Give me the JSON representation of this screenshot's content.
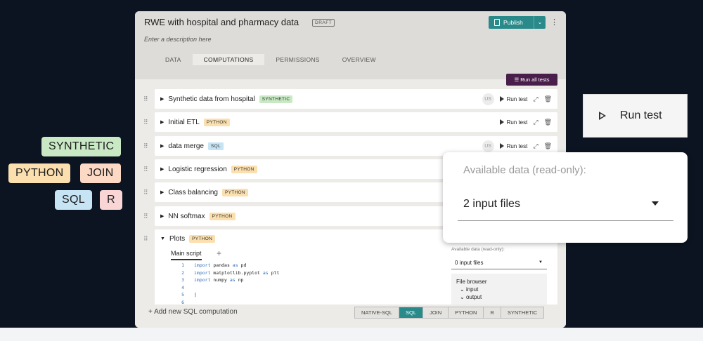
{
  "tags": [
    "SYNTHETIC",
    "PYTHON",
    "JOIN",
    "SQL",
    "R"
  ],
  "app": {
    "title": "RWE with hospital and pharmacy data",
    "status_badge": "DRAFT",
    "description_placeholder": "Enter a description here",
    "publish_label": "Publish",
    "tabs": [
      "DATA",
      "COMPUTATIONS",
      "PERMISSIONS",
      "OVERVIEW"
    ],
    "active_tab": "COMPUTATIONS",
    "run_all_label": "Run all tests"
  },
  "computations": [
    {
      "name": "Synthetic data from hospital",
      "type": "SYNTHETIC",
      "user": "US",
      "run": "Run test"
    },
    {
      "name": "Initial ETL",
      "type": "PYTHON",
      "run": "Run test"
    },
    {
      "name": "data merge",
      "type": "SQL",
      "user": "US",
      "run": "Run test"
    },
    {
      "name": "Logistic regression",
      "type": "PYTHON"
    },
    {
      "name": "Class balancing",
      "type": "PYTHON"
    },
    {
      "name": "NN softmax",
      "type": "PYTHON"
    }
  ],
  "expanded": {
    "name": "Plots",
    "type": "PYTHON",
    "tab_label": "Main script",
    "code_lines": [
      {
        "n": "1",
        "kw": "import",
        "rest": " pandas ",
        "kw2": "as",
        "rest2": " pd"
      },
      {
        "n": "2",
        "kw": "import",
        "rest": " matplotlib.pyplot ",
        "kw2": "as",
        "rest2": " plt"
      },
      {
        "n": "3",
        "kw": "import",
        "rest": " numpy ",
        "kw2": "as",
        "rest2": " np"
      },
      {
        "n": "4",
        "kw": "",
        "rest": "",
        "kw2": "",
        "rest2": ""
      },
      {
        "n": "5",
        "kw": "",
        "rest": "",
        "kw2": "",
        "rest2": ""
      },
      {
        "n": "6",
        "kw": "",
        "rest": "",
        "kw2": "",
        "rest2": ""
      }
    ],
    "available_label": "Available data (read-only):",
    "files_value": "0 input files",
    "file_browser_label": "File browser",
    "file_items": [
      "input",
      "output"
    ]
  },
  "footer": {
    "add_label": "+ Add new SQL computation",
    "languages": [
      "NATIVE-SQL",
      "SQL",
      "JOIN",
      "PYTHON",
      "R",
      "SYNTHETIC"
    ],
    "active_language": "SQL"
  },
  "callouts": {
    "run_test": "Run test",
    "available_label": "Available data (read-only):",
    "files_value": "2 input files"
  }
}
